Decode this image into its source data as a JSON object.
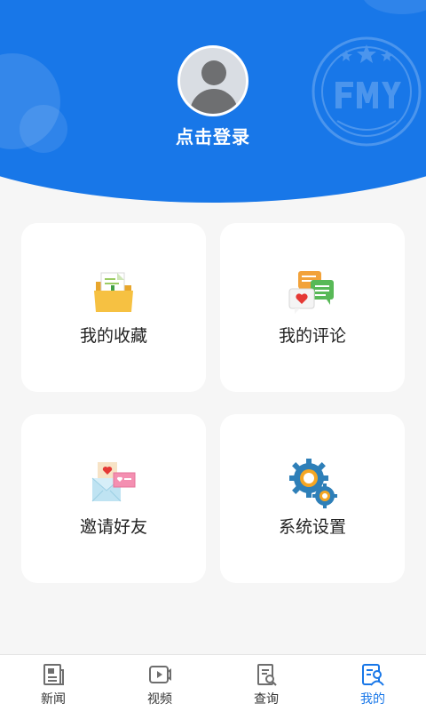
{
  "profile": {
    "login_text": "点击登录"
  },
  "colors": {
    "brand": "#1877e8",
    "tab_inactive": "#6e6e6e"
  },
  "menu": [
    {
      "label": "我的收藏",
      "icon": "favorites-folder-icon"
    },
    {
      "label": "我的评论",
      "icon": "comments-icon"
    },
    {
      "label": "邀请好友",
      "icon": "invite-envelope-icon"
    },
    {
      "label": "系统设置",
      "icon": "settings-gears-icon"
    }
  ],
  "tabs": [
    {
      "label": "新闻",
      "icon": "news-icon",
      "active": false
    },
    {
      "label": "视频",
      "icon": "video-icon",
      "active": false
    },
    {
      "label": "查询",
      "icon": "search-document-icon",
      "active": false
    },
    {
      "label": "我的",
      "icon": "profile-icon",
      "active": true
    }
  ]
}
